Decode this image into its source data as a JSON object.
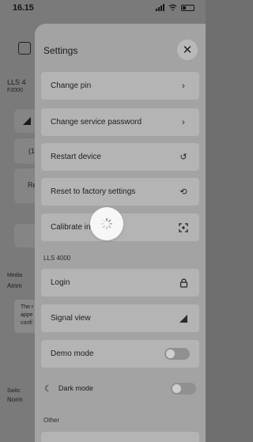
{
  "status_bar": {
    "time": "16.15"
  },
  "background": {
    "device_name": "LLS 4",
    "device_serial": "F2000",
    "temp_value": "(1",
    "restart_label": "Re",
    "media_label": "Media",
    "media_value": "Amm",
    "warning_lines": [
      "The r",
      "appe",
      "confi"
    ],
    "switch_label": "Switc",
    "switch_value": "Norm"
  },
  "sheet": {
    "title": "Settings",
    "rows": [
      {
        "label": "Change pin",
        "icon": "chevron-right-icon"
      },
      {
        "label": "Change service password",
        "icon": "chevron-right-icon"
      },
      {
        "label": "Restart device",
        "icon": "restart-icon"
      },
      {
        "label": "Reset to factory settings",
        "icon": "reset-icon"
      },
      {
        "label": "Calibrate in",
        "icon": "scan-icon"
      }
    ],
    "section_device": "LLS 4000",
    "device_rows": [
      {
        "label": "Login",
        "icon": "lock-icon"
      },
      {
        "label": "Signal view",
        "icon": "signal-icon"
      },
      {
        "label": "Demo mode",
        "icon": "toggle"
      }
    ],
    "dark_mode_label": "Dark mode",
    "section_other": "Other"
  },
  "colors": {
    "sheet_bg": "#a3a3a3",
    "row_bg": "#b4b4b4",
    "overlay": "#7a7a7a",
    "loader_bg": "#f7f7f7"
  }
}
